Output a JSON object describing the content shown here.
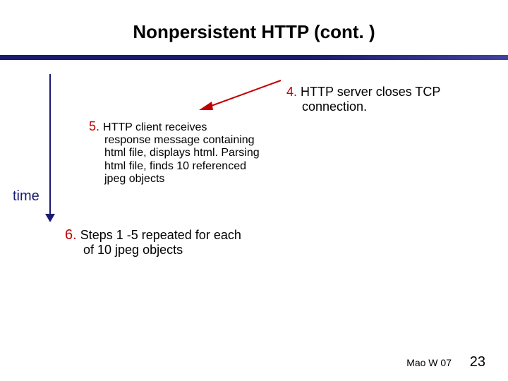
{
  "title": "Nonpersistent HTTP (cont. )",
  "time_label": "time",
  "step4": {
    "num": "4.",
    "head": "HTTP server closes TCP",
    "body": "connection."
  },
  "step5": {
    "num": "5.",
    "head": "HTTP client receives",
    "body": "response message containing html file, displays html.  Parsing html file, finds 10 referenced jpeg  objects"
  },
  "step6": {
    "num": "6.",
    "head": "Steps 1 -5 repeated for each",
    "body": "of 10 jpeg objects"
  },
  "footer": {
    "credit": "Mao W 07",
    "page": "23"
  },
  "colors": {
    "accent_rule": "#1a1a70",
    "step_number": "#c00000",
    "arrow": "#c00000"
  }
}
